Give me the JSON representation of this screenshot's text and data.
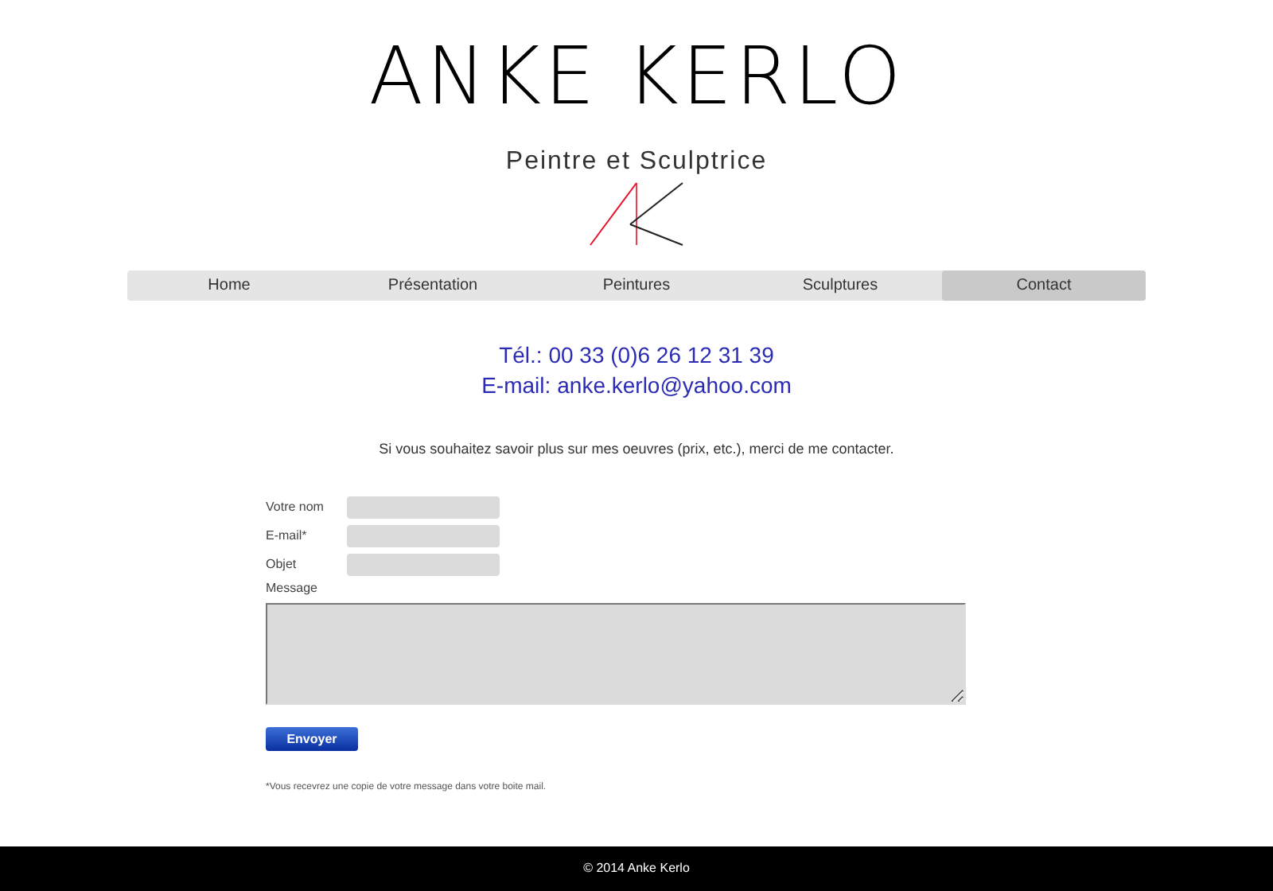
{
  "header": {
    "title": "ANKE KERLO",
    "subtitle": "Peintre et Sculptrice"
  },
  "nav": [
    {
      "label": "Home",
      "selected": false
    },
    {
      "label": "Présentation",
      "selected": false
    },
    {
      "label": "Peintures",
      "selected": false
    },
    {
      "label": "Sculptures",
      "selected": false
    },
    {
      "label": "Contact",
      "selected": true
    }
  ],
  "contact": {
    "phone": "Tél.: 00 33 (0)6 26 12 31 39",
    "email_label": "E-mail:",
    "email": "anke.kerlo@yahoo.com"
  },
  "intro": "Si vous souhaitez savoir plus sur mes oeuvres (prix, etc.), merci de me contacter.",
  "form": {
    "fields": [
      {
        "label": "Votre nom"
      },
      {
        "label": "E-mail*"
      },
      {
        "label": "Objet"
      }
    ],
    "message_label": "Message",
    "submit": "Envoyer",
    "note": "*Vous recevrez une copie de votre message dans votre boite mail."
  },
  "footer": "© 2014 Anke Kerlo"
}
